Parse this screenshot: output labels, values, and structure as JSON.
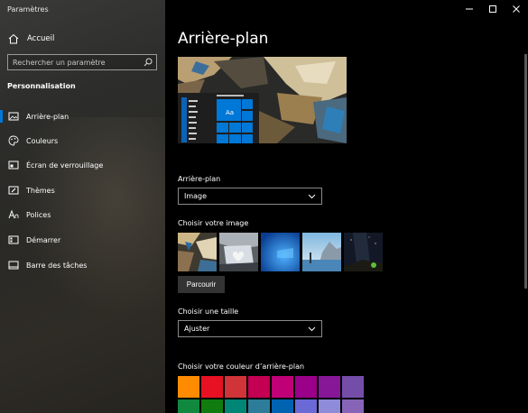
{
  "window": {
    "title": "Paramètres"
  },
  "sidebar": {
    "home_label": "Accueil",
    "search_placeholder": "Rechercher un paramètre",
    "section_title": "Personnalisation",
    "items": [
      {
        "label": "Arrière-plan",
        "icon": "picture-icon",
        "active": true
      },
      {
        "label": "Couleurs",
        "icon": "palette-icon",
        "active": false
      },
      {
        "label": "Écran de verrouillage",
        "icon": "lock-screen-icon",
        "active": false
      },
      {
        "label": "Thèmes",
        "icon": "brush-icon",
        "active": false
      },
      {
        "label": "Polices",
        "icon": "font-icon",
        "active": false
      },
      {
        "label": "Démarrer",
        "icon": "start-icon",
        "active": false
      },
      {
        "label": "Barre des tâches",
        "icon": "taskbar-icon",
        "active": false
      }
    ]
  },
  "main": {
    "title": "Arrière-plan",
    "preview_tile_text": "Aa",
    "background_label": "Arrière-plan",
    "background_value": "Image",
    "choose_image_label": "Choisir votre image",
    "browse_label": "Parcourir",
    "size_label": "Choisir une taille",
    "size_value": "Ajuster",
    "color_label": "Choisir votre couleur d’arrière-plan"
  },
  "colors": {
    "accent": "#0078d7",
    "swatches": [
      "#ff8c00",
      "#e81123",
      "#d13438",
      "#c30052",
      "#bf0077",
      "#9a0089",
      "#881798",
      "#744da9",
      "#10893e",
      "#107c10",
      "#018574",
      "#2d7d9a",
      "#0063b1",
      "#6b69d6",
      "#8e8cd8",
      "#8764b8"
    ]
  }
}
